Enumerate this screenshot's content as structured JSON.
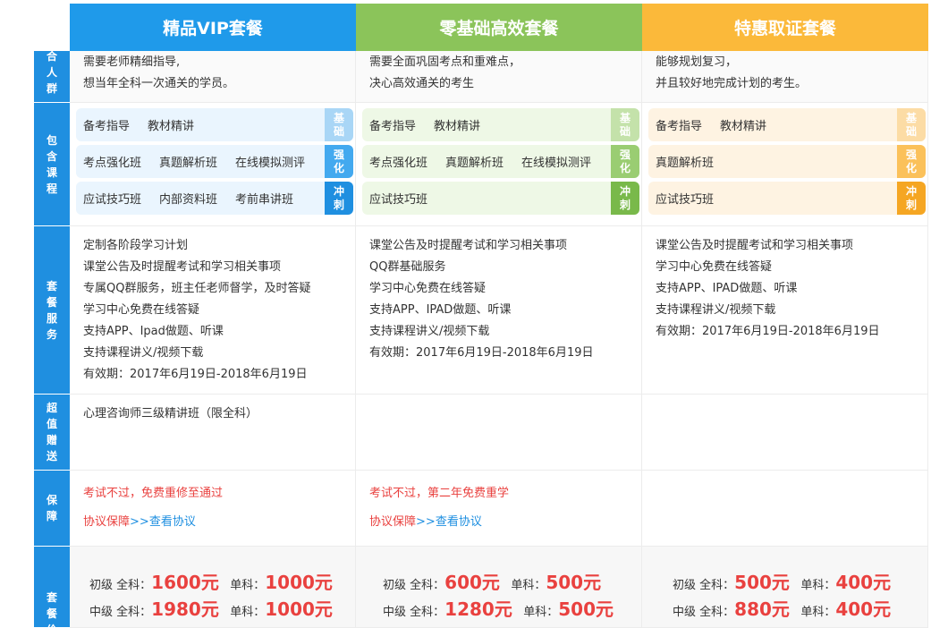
{
  "headers": [
    {
      "title": "精品VIP套餐",
      "color": "#1f9aea"
    },
    {
      "title": "零基础高效套餐",
      "color": "#8bc45a"
    },
    {
      "title": "特惠取证套餐",
      "color": "#fbb93a"
    }
  ],
  "row_labels": {
    "audience": "合人群",
    "courses": "包含课程",
    "services": "套餐服务",
    "gifts": "超值赠送",
    "guarantee": "保障",
    "price": "套餐价"
  },
  "audience": [
    [
      "需要老师精细指导,",
      "想当年全科一次通关的学员。"
    ],
    [
      "需要全面巩固考点和重难点，",
      "决心高效通关的考生"
    ],
    [
      "能够规划复习，",
      "并且较好地完成计划的考生。"
    ]
  ],
  "course_tags": [
    "基础",
    "强化",
    "冲刺"
  ],
  "courses": [
    {
      "tag_color": "#1f9aea",
      "tag_light": "#a9d6f6",
      "row_bg": "#eaf5fe",
      "rows": [
        [
          "备考指导",
          "教材精讲"
        ],
        [
          "考点强化班",
          "真题解析班",
          "在线模拟测评"
        ],
        [
          "应试技巧班",
          "内部资料班",
          "考前串讲班"
        ]
      ]
    },
    {
      "tag_color": "#79b94a",
      "tag_light": "#c4e2aa",
      "row_bg": "#eef8e6",
      "rows": [
        [
          "备考指导",
          "教材精讲"
        ],
        [
          "考点强化班",
          "真题解析班",
          "在线模拟测评"
        ],
        [
          "应试技巧班"
        ]
      ]
    },
    {
      "tag_color": "#f5a623",
      "tag_light": "#fcdca5",
      "row_bg": "#fef3e2",
      "rows": [
        [
          "备考指导",
          "教材精讲"
        ],
        [
          "真题解析班"
        ],
        [
          "应试技巧班"
        ]
      ]
    }
  ],
  "services": [
    [
      "定制各阶段学习计划",
      "课堂公告及时提醒考试和学习相关事项",
      "专属QQ群服务，班主任老师督学，及时答疑",
      "学习中心免费在线答疑",
      "支持APP、Ipad做题、听课",
      "支持课程讲义/视频下载",
      "有效期：2017年6月19日-2018年6月19日"
    ],
    [
      "课堂公告及时提醒考试和学习相关事项",
      "QQ群基础服务",
      "学习中心免费在线答疑",
      "支持APP、IPAD做题、听课",
      "支持课程讲义/视频下载",
      "有效期：2017年6月19日-2018年6月19日"
    ],
    [
      "课堂公告及时提醒考试和学习相关事项",
      "学习中心免费在线答疑",
      "支持APP、IPAD做题、听课",
      "支持课程讲义/视频下载",
      "有效期：2017年6月19日-2018年6月19日"
    ]
  ],
  "gifts": [
    "心理咨询师三级精讲班（限全科）",
    "",
    ""
  ],
  "guarantee": [
    {
      "text": "考试不过，免费重修至通过",
      "link_prefix": "协议保障",
      "link_arrows": ">>",
      "link_text": "查看协议"
    },
    {
      "text": "考试不过，第二年免费重学",
      "link_prefix": "协议保障",
      "link_arrows": ">>",
      "link_text": "查看协议"
    },
    {
      "text": "",
      "link_prefix": "",
      "link_arrows": "",
      "link_text": ""
    }
  ],
  "prices": [
    [
      {
        "level": "初级",
        "all_label": "全科：",
        "all_price": "1600元",
        "single_label": "单科：",
        "single_price": "1000元"
      },
      {
        "level": "中级",
        "all_label": "全科：",
        "all_price": "1980元",
        "single_label": "单科：",
        "single_price": "1000元"
      }
    ],
    [
      {
        "level": "初级",
        "all_label": "全科：",
        "all_price": "600元",
        "single_label": "单科：",
        "single_price": "500元"
      },
      {
        "level": "中级",
        "all_label": "全科：",
        "all_price": "1280元",
        "single_label": "单科：",
        "single_price": "500元"
      }
    ],
    [
      {
        "level": "初级",
        "all_label": "全科：",
        "all_price": "500元",
        "single_label": "单科：",
        "single_price": "400元"
      },
      {
        "level": "中级",
        "all_label": "全科：",
        "all_price": "880元",
        "single_label": "单科：",
        "single_price": "400元"
      }
    ]
  ]
}
